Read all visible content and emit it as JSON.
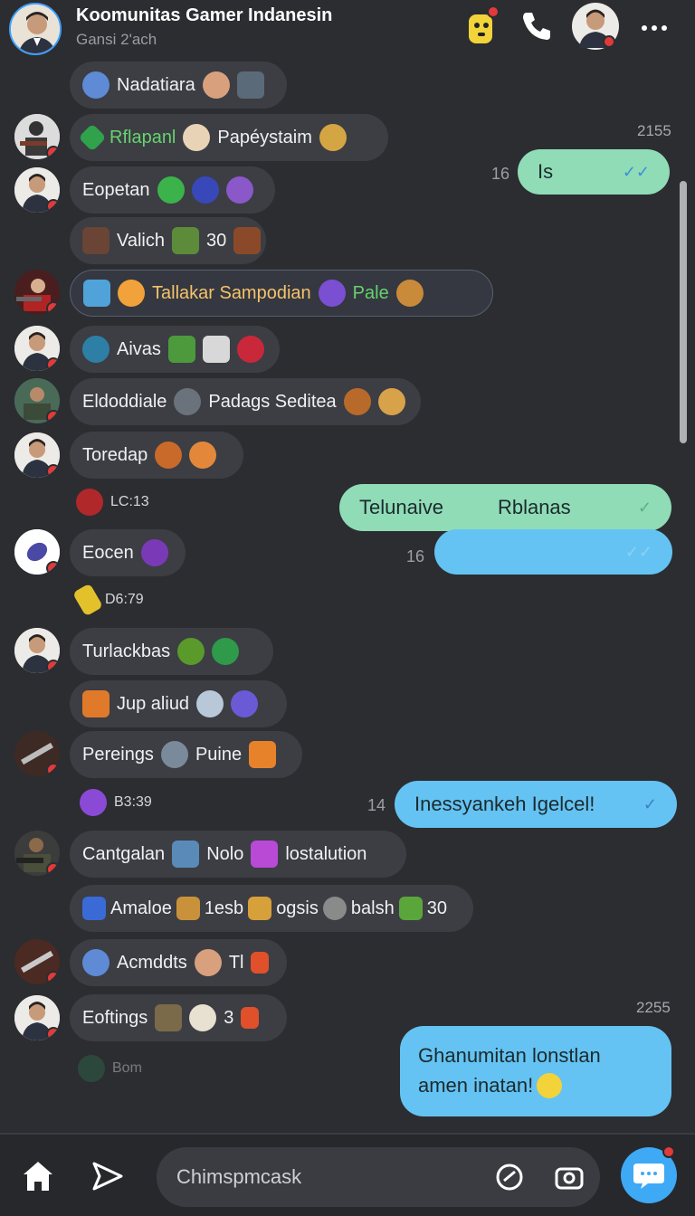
{
  "header": {
    "title": "Koomunitas Gamer Indanesin",
    "subtitle": "Gansi 2'ach"
  },
  "messages": [
    {
      "text": "Nadatiara"
    },
    {
      "text1": "Rflapanl",
      "text2": "Papéystaim"
    },
    {
      "text": "Eopetan"
    },
    {
      "text": "Valich",
      "count": "30"
    },
    {
      "text1": "Tallakar Sampodian",
      "text2": "Pale"
    },
    {
      "text": "Aivas"
    },
    {
      "text1": "Eldoddiale",
      "text2": "Padags Seditea"
    },
    {
      "text": "Toredap"
    },
    {
      "text": "Eocen"
    },
    {
      "text": "Turlackbas"
    },
    {
      "text": "Jup aliud"
    },
    {
      "text1": "Pereings",
      "text2": "Puine"
    },
    {
      "text1": "Cantgalan",
      "text2": "Nolo",
      "text3": "lostalution"
    },
    {
      "text1": "Amaloe",
      "text2": "1esb",
      "text3": "ogsis",
      "text4": "balsh",
      "count": "30"
    },
    {
      "text1": "Acmddts",
      "text2": "Tl"
    },
    {
      "text": "Eoftings",
      "count": "3"
    }
  ],
  "system": {
    "lc": "LC:13",
    "d6": "D6:79",
    "b3": "B3:39",
    "bom": "Bom"
  },
  "outgoing": {
    "ts1": "2155",
    "out1_side": "16",
    "out1_text": "Is",
    "out2_a": "Telunaive",
    "out2_b": "Rblanas",
    "out3_side": "16",
    "out4_side": "14",
    "out4_text": "Inessyankeh Igelcel!",
    "ts2": "2255",
    "out5_line1": "Ghanumitan lonstlan",
    "out5_line2": "amen inatan!"
  },
  "composer": {
    "placeholder": "Chimspmcask"
  },
  "colors": {
    "background": "#2b2d31",
    "bubble_mint": "#8fdcb7",
    "bubble_sky": "#64c3f2",
    "accent_blue": "#3ea9f4",
    "notification_red": "#e03a3a"
  }
}
